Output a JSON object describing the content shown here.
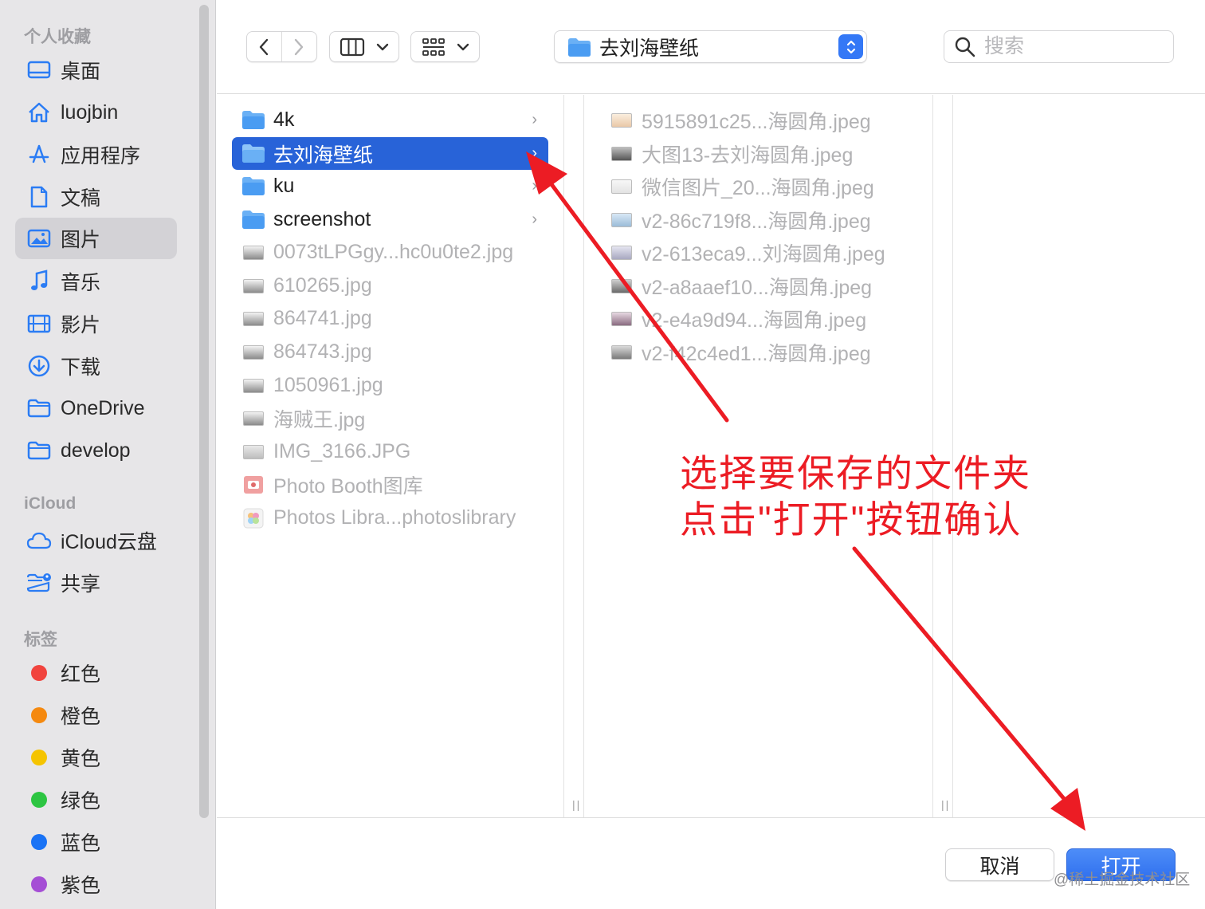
{
  "sidebar": {
    "favorites_header": "个人收藏",
    "favorites": [
      {
        "label": "桌面",
        "icon": "desktop-icon"
      },
      {
        "label": "luojbin",
        "icon": "home-icon"
      },
      {
        "label": "应用程序",
        "icon": "applications-icon"
      },
      {
        "label": "文稿",
        "icon": "document-icon"
      },
      {
        "label": "图片",
        "icon": "photo-icon",
        "selected": true
      },
      {
        "label": "音乐",
        "icon": "music-note-icon"
      },
      {
        "label": "影片",
        "icon": "film-icon"
      },
      {
        "label": "下载",
        "icon": "download-icon"
      },
      {
        "label": "OneDrive",
        "icon": "folder-icon"
      },
      {
        "label": "develop",
        "icon": "folder-icon"
      }
    ],
    "icloud_header": "iCloud",
    "icloud": [
      {
        "label": "iCloud云盘",
        "icon": "cloud-icon"
      },
      {
        "label": "共享",
        "icon": "shared-folder-icon"
      }
    ],
    "tags_header": "标签",
    "tags": [
      {
        "label": "红色",
        "color": "#f1443e"
      },
      {
        "label": "橙色",
        "color": "#f5890f"
      },
      {
        "label": "黄色",
        "color": "#f5c400"
      },
      {
        "label": "绿色",
        "color": "#2dc542"
      },
      {
        "label": "蓝色",
        "color": "#1a73f5"
      },
      {
        "label": "紫色",
        "color": "#a54ed5"
      }
    ]
  },
  "toolbar": {
    "path_label": "去刘海壁纸",
    "search_placeholder": "搜索"
  },
  "column1": {
    "items": [
      {
        "label": "4k",
        "type": "folder",
        "has_children": true
      },
      {
        "label": "去刘海壁纸",
        "type": "folder",
        "has_children": true,
        "selected": true
      },
      {
        "label": "ku",
        "type": "folder",
        "has_children": true
      },
      {
        "label": "screenshot",
        "type": "folder",
        "has_children": true
      },
      {
        "label": "0073tLPGgy...hc0u0te2.jpg",
        "type": "image"
      },
      {
        "label": "610265.jpg",
        "type": "image"
      },
      {
        "label": "864741.jpg",
        "type": "image"
      },
      {
        "label": "864743.jpg",
        "type": "image"
      },
      {
        "label": "1050961.jpg",
        "type": "image"
      },
      {
        "label": "海贼王.jpg",
        "type": "image"
      },
      {
        "label": "IMG_3166.JPG",
        "type": "image"
      },
      {
        "label": "Photo Booth图库",
        "type": "photobooth"
      },
      {
        "label": "Photos Libra...photoslibrary",
        "type": "photos"
      }
    ]
  },
  "column2": {
    "items": [
      {
        "label": "5915891c25...海圆角.jpeg"
      },
      {
        "label": "大图13-去刘海圆角.jpeg"
      },
      {
        "label": "微信图片_20...海圆角.jpeg"
      },
      {
        "label": "v2-86c719f8...海圆角.jpeg"
      },
      {
        "label": "v2-613eca9...刘海圆角.jpeg"
      },
      {
        "label": "v2-a8aaef10...海圆角.jpeg"
      },
      {
        "label": "v2-e4a9d94...海圆角.jpeg"
      },
      {
        "label": "v2-f42c4ed1...海圆角.jpeg"
      }
    ]
  },
  "buttons": {
    "cancel": "取消",
    "open": "打开"
  },
  "annotation": {
    "line1": "选择要保存的文件夹",
    "line2": "点击\"打开\"按钮确认",
    "color": "#ec1c24"
  },
  "watermark": "@稀土掘金技术社区"
}
